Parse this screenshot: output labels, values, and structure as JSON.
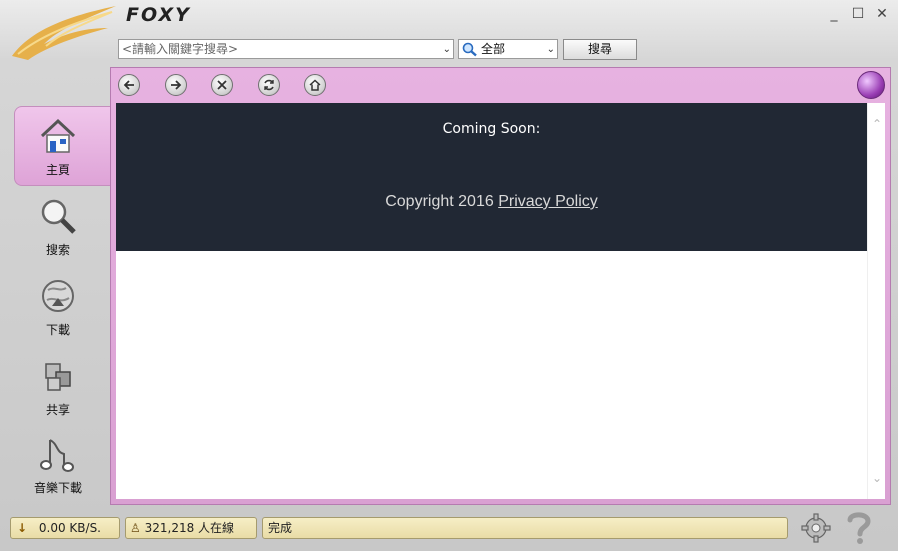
{
  "app": {
    "brand": "FOXY"
  },
  "window_controls": {
    "minimize": "_",
    "maximize": "☐",
    "close": "✕"
  },
  "search": {
    "placeholder": "<請輸入關鍵字搜尋>",
    "category": "全部",
    "button": "搜尋"
  },
  "nav": {
    "back_icon": "back-icon",
    "forward_icon": "forward-icon",
    "stop_icon": "stop-icon",
    "refresh_icon": "refresh-icon",
    "home_icon": "home-icon"
  },
  "page": {
    "coming_soon": "Coming Soon:",
    "copyright": "Copyright 2016",
    "privacy_link": "Privacy Policy"
  },
  "sidebar": {
    "items": [
      {
        "label": "主頁",
        "icon": "house-icon",
        "active": true
      },
      {
        "label": "搜索",
        "icon": "magnifier-icon",
        "active": false
      },
      {
        "label": "下載",
        "icon": "globe-download-icon",
        "active": false
      },
      {
        "label": "共享",
        "icon": "share-cubes-icon",
        "active": false
      },
      {
        "label": "音樂下載",
        "icon": "music-note-icon",
        "active": false
      }
    ]
  },
  "statusbar": {
    "speed": "0.00 KB/S.",
    "online": "321,218 人在線",
    "status": "完成"
  },
  "colors": {
    "accent_pink": "#dea3d7",
    "banner_bg": "#212834"
  }
}
